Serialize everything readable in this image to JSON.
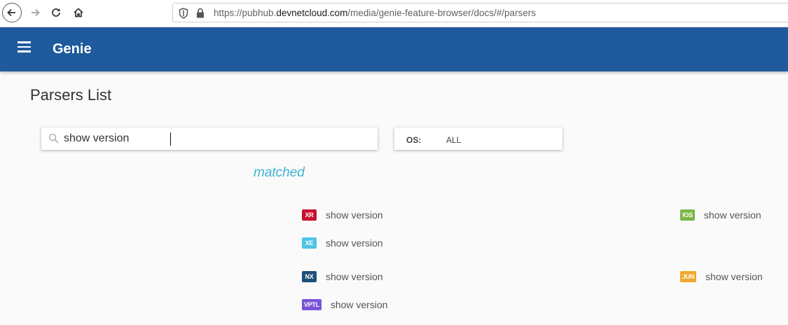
{
  "browser": {
    "url_prefix": "https://pubhub.",
    "url_host": "devnetcloud.com",
    "url_path": "/media/genie-feature-browser/docs/#/parsers"
  },
  "app": {
    "title": "Genie"
  },
  "page": {
    "title": "Parsers List"
  },
  "search": {
    "value": "show version"
  },
  "os_filter": {
    "label": "OS:",
    "value": "ALL"
  },
  "results": {
    "heading": "matched",
    "items": [
      {
        "os": "XR",
        "color": "#c8102e",
        "name": "show version"
      },
      {
        "os": "IOS",
        "color": "#7ab648",
        "name": "show version"
      },
      {
        "os": "XE",
        "color": "#4fc3e8",
        "name": "show version"
      },
      {
        "os": "NX",
        "color": "#1f4e79",
        "name": "show version"
      },
      {
        "os": "JUN",
        "color": "#f0a830",
        "name": "show version"
      },
      {
        "os": "VPTL",
        "color": "#7b52d9",
        "name": "show version"
      }
    ]
  }
}
